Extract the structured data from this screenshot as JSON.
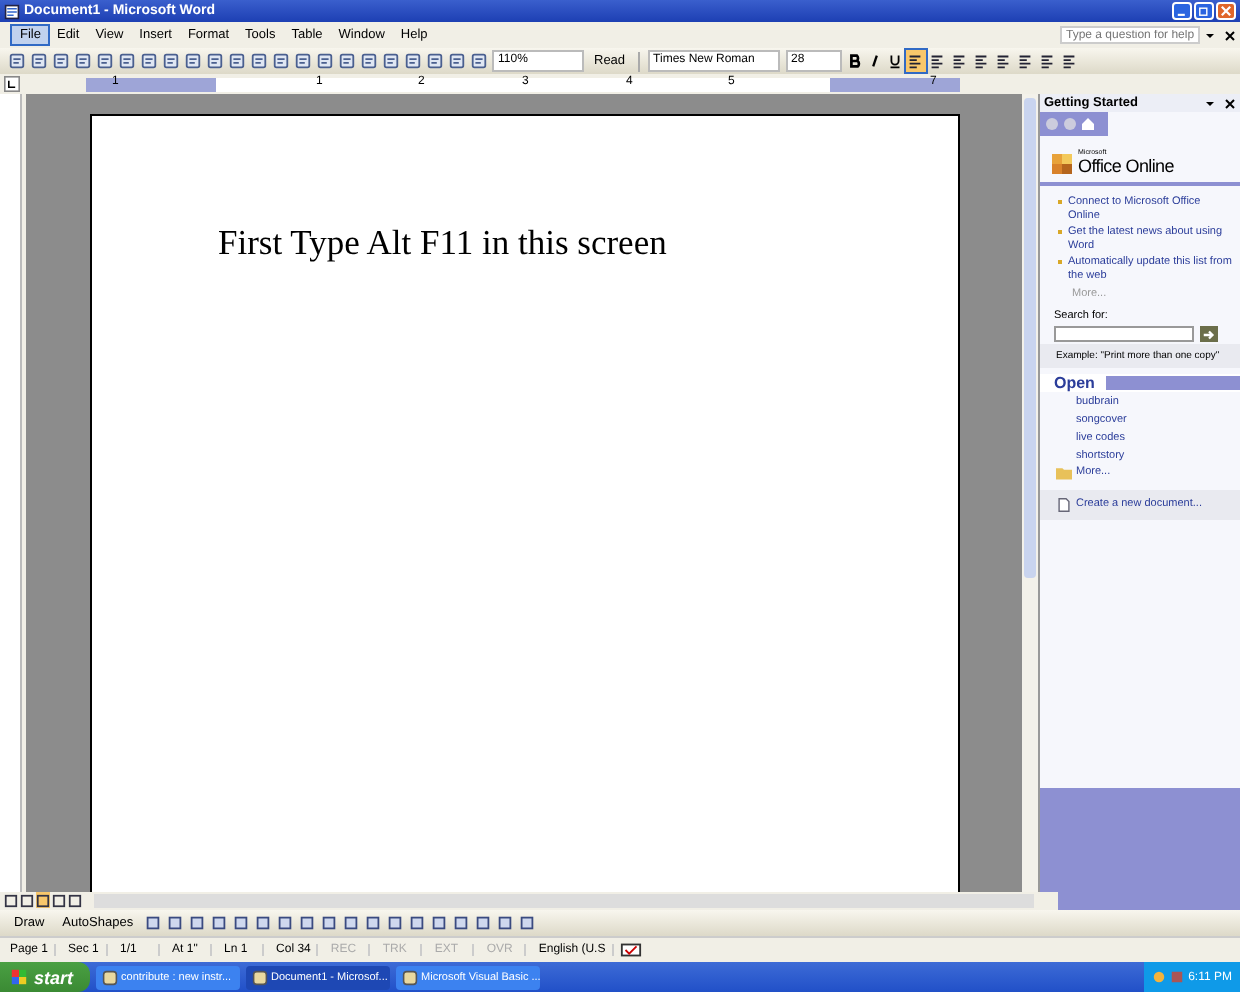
{
  "window": {
    "title": "Document1 - Microsoft Word"
  },
  "menu": [
    {
      "label": "File",
      "selected": true
    },
    {
      "label": "Edit",
      "selected": false
    },
    {
      "label": "View",
      "selected": false
    },
    {
      "label": "Insert",
      "selected": false
    },
    {
      "label": "Format",
      "selected": false
    },
    {
      "label": "Tools",
      "selected": false
    },
    {
      "label": "Table",
      "selected": false
    },
    {
      "label": "Window",
      "selected": false
    },
    {
      "label": "Help",
      "selected": false
    }
  ],
  "help": {
    "placeholder": "Type a question for help"
  },
  "toolbar": {
    "zoom": "110%",
    "read": "Read",
    "font": "Times New Roman",
    "size": "28"
  },
  "ruler": {
    "labels": [
      "1",
      "1",
      "2",
      "3",
      "4",
      "5",
      "7"
    ]
  },
  "document": {
    "text": "First Type Alt F11 in this screen"
  },
  "task_pane": {
    "title": "Getting Started",
    "logo_small": "Microsoft",
    "logo": "Office Online",
    "links": [
      "Connect to Microsoft Office Online",
      "Get the latest news about using Word",
      "Automatically update this list from the web"
    ],
    "more_links": "More...",
    "search_label": "Search for:",
    "example": "Example:  \"Print more than one copy\"",
    "open_title": "Open",
    "files": [
      "budbrain",
      "songcover",
      "live codes",
      "shortstory"
    ],
    "more_files": "More...",
    "create": "Create a new document..."
  },
  "draw_toolbar": {
    "draw": "Draw",
    "autoshapes": "AutoShapes"
  },
  "status_bar": [
    {
      "text": "Page 1",
      "disabled": false
    },
    {
      "text": "Sec 1",
      "disabled": false
    },
    {
      "text": "1/1",
      "disabled": false
    },
    {
      "text": "At 1\"",
      "disabled": false
    },
    {
      "text": "Ln 1",
      "disabled": false
    },
    {
      "text": "Col 34",
      "disabled": false
    },
    {
      "text": "REC",
      "disabled": true
    },
    {
      "text": "TRK",
      "disabled": true
    },
    {
      "text": "EXT",
      "disabled": true
    },
    {
      "text": "OVR",
      "disabled": true
    },
    {
      "text": "English (U.S",
      "disabled": false
    }
  ],
  "taskbar": {
    "start": "start",
    "tasks": [
      {
        "label": "contribute : new instr...",
        "selected": false
      },
      {
        "label": "Document1 - Microsof...",
        "selected": true
      },
      {
        "label": "Microsoft Visual Basic ...",
        "selected": false
      }
    ],
    "clock": "6:11 PM"
  }
}
